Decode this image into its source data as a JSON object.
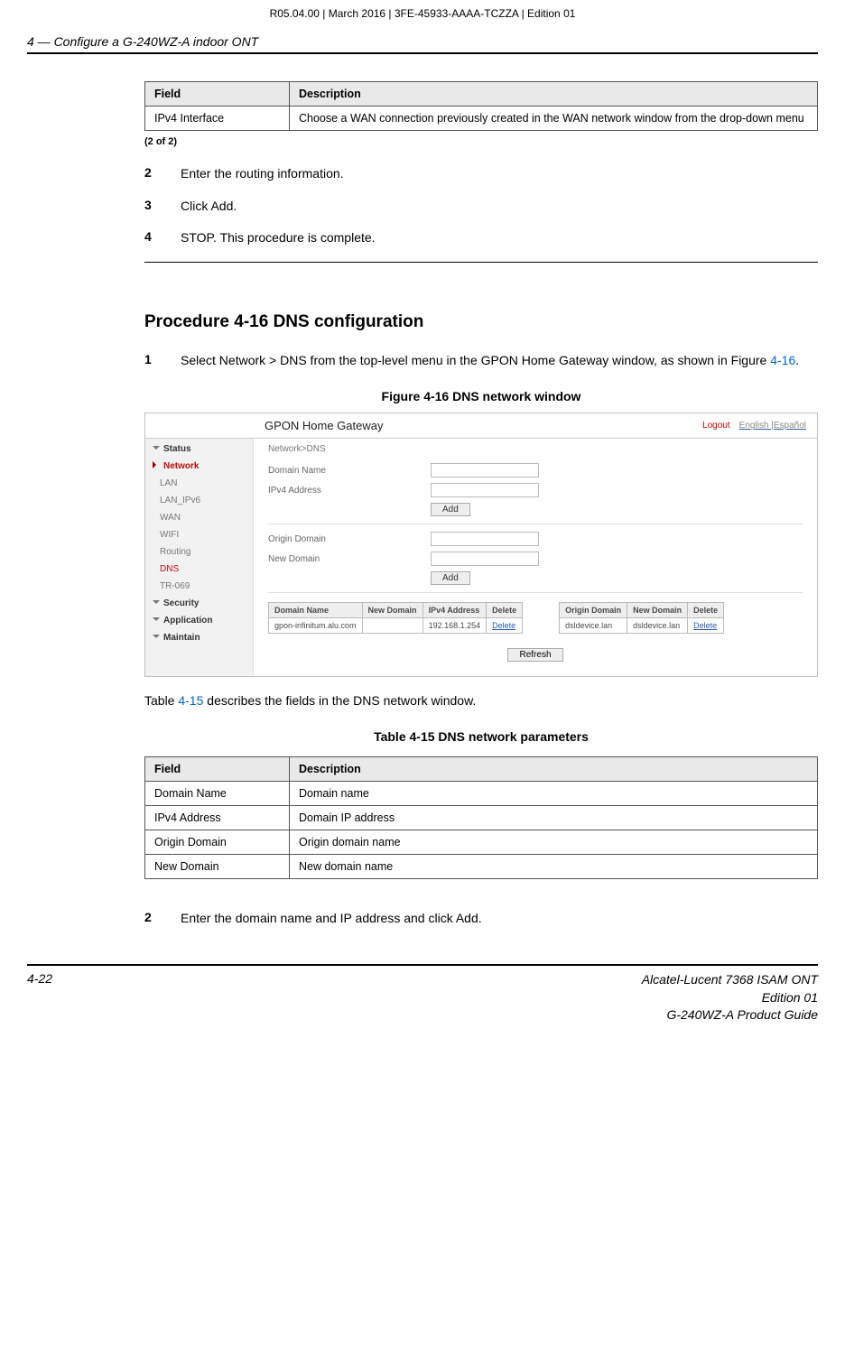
{
  "top_info": "R05.04.00 | March 2016 | 3FE-45933-AAAA-TCZZA | Edition 01",
  "chapter": "4 —  Configure a G-240WZ-A indoor ONT",
  "t1": {
    "h_field": "Field",
    "h_desc": "Description",
    "r_field": "IPv4 Interface",
    "r_desc": "Choose a WAN connection previously created in the WAN network window from the drop-down menu"
  },
  "of2": "(2 of 2)",
  "steps_a": {
    "s2n": "2",
    "s2t": "Enter the routing information.",
    "s3n": "3",
    "s3t": "Click Add.",
    "s4n": "4",
    "s4t": "STOP. This procedure is complete."
  },
  "proc_title": "Procedure 4-16  DNS configuration",
  "step1": {
    "n": "1",
    "t1": "Select Network > DNS from the top-level menu in the GPON Home Gateway window, as shown in Figure ",
    "link": "4-16",
    "t2": "."
  },
  "fig_title": "Figure 4-16  DNS network window",
  "screenshot": {
    "gateway_title": "GPON Home Gateway",
    "logout": "Logout",
    "lang1": "English",
    "lang_sep": " |",
    "lang2": "Español",
    "breadcrumb": "Network>DNS",
    "side": {
      "status": "Status",
      "network": "Network",
      "lan": "LAN",
      "lanv6": "LAN_IPv6",
      "wan": "WAN",
      "wifi": "WIFI",
      "routing": "Routing",
      "dns": "DNS",
      "tr": "TR-069",
      "security": "Security",
      "application": "Application",
      "maintain": "Maintain"
    },
    "form": {
      "domain_name": "Domain Name",
      "ipv4_addr": "IPv4 Address",
      "add": "Add",
      "origin_domain": "Origin Domain",
      "new_domain": "New Domain"
    },
    "tblA": {
      "h1": "Domain Name",
      "h2": "New Domain",
      "h3": "IPv4 Address",
      "h4": "Delete",
      "r1c1": "gpon-infinitum.alu.com",
      "r1c2": "",
      "r1c3": "192.168.1.254",
      "r1c4": "Delete"
    },
    "tblB": {
      "h1": "Origin Domain",
      "h2": "New Domain",
      "h3": "Delete",
      "r1c1": "dsldevice.lan",
      "r1c2": "dsldevice.lan",
      "r1c3": "Delete"
    },
    "refresh": "Refresh"
  },
  "fig_desc1": "Table ",
  "fig_desc_link": "4-15",
  "fig_desc2": " describes the fields in the DNS network window.",
  "tbl_title": "Table 4-15 DNS network parameters",
  "t2": {
    "h_field": "Field",
    "h_desc": "Description",
    "r1f": "Domain Name",
    "r1d": "Domain name",
    "r2f": "IPv4 Address",
    "r2d": "Domain IP address",
    "r3f": "Origin Domain",
    "r3d": "Origin domain name",
    "r4f": "New Domain",
    "r4d": "New domain name"
  },
  "step2": {
    "n": "2",
    "t": "Enter the domain name and IP address and click Add."
  },
  "footer": {
    "pn": "4-22",
    "r1": "Alcatel-Lucent 7368 ISAM ONT",
    "r2": "Edition 01",
    "r3": "G-240WZ-A Product Guide"
  }
}
